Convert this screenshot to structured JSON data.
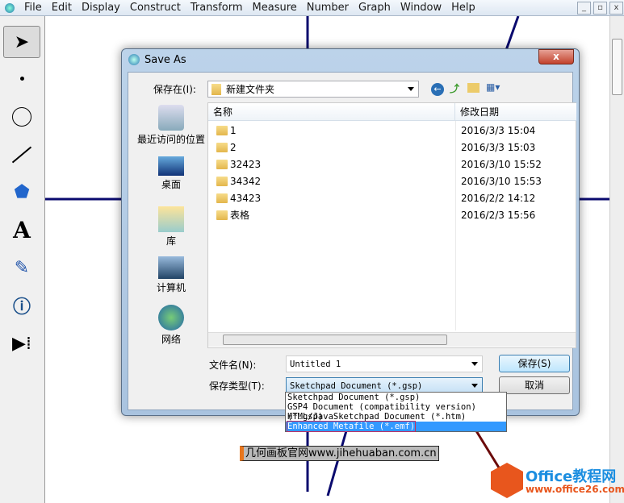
{
  "app": {
    "menu": [
      "File",
      "Edit",
      "Display",
      "Construct",
      "Transform",
      "Measure",
      "Number",
      "Graph",
      "Window",
      "Help"
    ],
    "window_buttons": [
      "_",
      "▫",
      "x"
    ]
  },
  "toolbox": {
    "tools": [
      "arrow-tool",
      "point-tool",
      "compass-tool",
      "straightedge-tool",
      "polygon-tool",
      "text-tool",
      "marker-tool",
      "information-tool",
      "custom-tool"
    ]
  },
  "dialog": {
    "title": "Save As",
    "close": "x",
    "save_in_label": "保存在(I):",
    "save_in_value": "新建文件夹",
    "places": [
      "最近访问的位置",
      "桌面",
      "库",
      "计算机",
      "网络"
    ],
    "columns": [
      "名称",
      "修改日期"
    ],
    "files": [
      {
        "name": "1",
        "date": "2016/3/3 15:04"
      },
      {
        "name": "2",
        "date": "2016/3/3 15:03"
      },
      {
        "name": "32423",
        "date": "2016/3/10 15:52"
      },
      {
        "name": "34342",
        "date": "2016/3/10 15:53"
      },
      {
        "name": "43423",
        "date": "2016/2/2 14:12"
      },
      {
        "name": "表格",
        "date": "2016/2/3 15:56"
      }
    ],
    "filename_label": "文件名(N):",
    "filename_value": "Untitled 1",
    "filetype_label": "保存类型(T):",
    "filetype_value": "Sketchpad Document (*.gsp)",
    "save_button": "保存(S)",
    "cancel_button": "取消",
    "filetype_options": [
      "Sketchpad Document (*.gsp)",
      "GSP4 Document (compatibility version) (*.gsp)",
      "HTML/JavaSketchpad Document (*.htm)",
      "Enhanced Metafile (*.emf)"
    ],
    "highlighted_option": "Enhanced Metafile (*.emf)"
  },
  "watermarks": {
    "site": "几何画板官网www.jihehuaban.com.cn",
    "office_title": "Office教程网",
    "office_url": "www.office26.com"
  },
  "colors": {
    "line": "#0a0a6e",
    "red_line": "#6b0a0a",
    "highlight": "#3399ff",
    "office": "#e8561d",
    "office_blue": "#1c8ee0"
  }
}
